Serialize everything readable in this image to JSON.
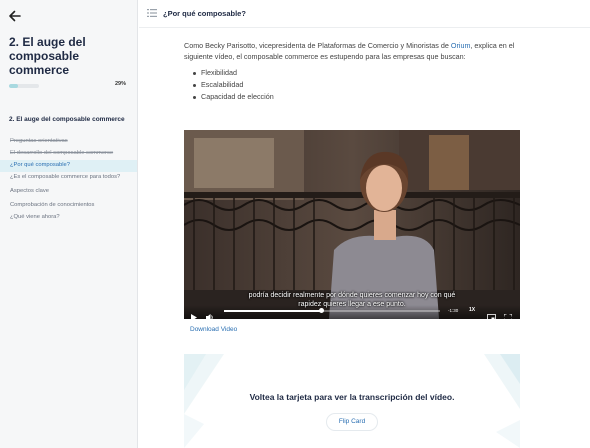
{
  "sidebar": {
    "course_title": "2. El auge del composable commerce",
    "progress_value": 0.29,
    "progress_text": "29%",
    "lesson_title": "2. El auge del composable commerce",
    "items": [
      {
        "label": "Preguntas orientativas",
        "state": "done"
      },
      {
        "label": "El desarrollo del composable commerce",
        "state": "done"
      },
      {
        "label": "¿Por qué composable?",
        "state": "active"
      },
      {
        "label": "¿Es el composable commerce para todos?",
        "state": "normal"
      },
      {
        "label": "Aspectos clave",
        "state": "normal"
      },
      {
        "label": "Comprobación de conocimientos",
        "state": "normal"
      },
      {
        "label": "¿Qué viene ahora?",
        "state": "normal"
      }
    ]
  },
  "header": {
    "title": "¿Por qué composable?"
  },
  "content": {
    "intro_before": "Como Becky Parisotto, vicepresidenta de Plataformas de Comercio y Minoristas de ",
    "intro_link": "Orium",
    "intro_after": ", explica en el siguiente vídeo, el composable commerce es estupendo para las empresas que buscan:",
    "bullets": [
      "Flexibilidad",
      "Escalabilidad",
      "Capacidad de elección"
    ]
  },
  "video": {
    "subtitle_line1": "podría decidir realmente por dónde quieres comenzar hoy con qué",
    "subtitle_line2": "rapidez quieres llegar a ese punto.",
    "progress_value": 0.45,
    "time_text": "-1:30",
    "speed_text": "1X",
    "download_label": "Download Video"
  },
  "flip_card": {
    "heading": "Voltea la tarjeta para ver la transcripción del vídeo.",
    "button_label": "Flip Card"
  },
  "colors": {
    "accent": "#2a6fb2",
    "progress": "#a8d9e0",
    "active_bg": "#dff0f5",
    "title": "#1f2a44"
  }
}
